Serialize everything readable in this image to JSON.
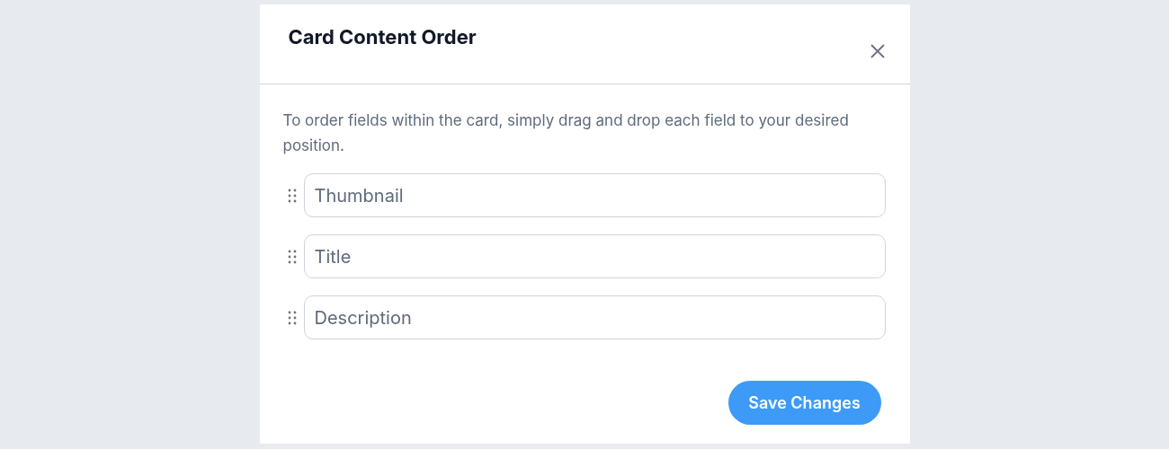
{
  "dialog": {
    "title": "Card Content Order",
    "description": "To order fields within the card, simply drag and drop each field to your desired position.",
    "fields": [
      {
        "value": "Thumbnail"
      },
      {
        "value": "Title"
      },
      {
        "value": "Description"
      }
    ],
    "save_button": "Save Changes"
  }
}
